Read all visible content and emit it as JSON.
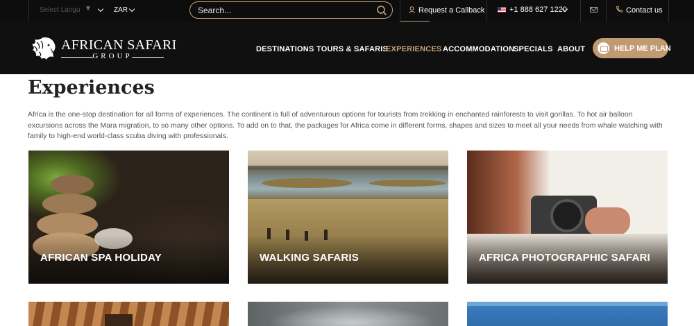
{
  "topbar": {
    "language": "Select Langu",
    "currency": "ZAR",
    "search_placeholder": "Search...",
    "callback_label": "Request a Callback",
    "phone": "+1 888 627 1220",
    "contact_label": "Contact us"
  },
  "logo": {
    "title": "AFRICAN SAFARI",
    "subtitle": "GROUP"
  },
  "nav": {
    "items": [
      {
        "label": "DESTINATIONS"
      },
      {
        "label": "TOURS & SAFARIS"
      },
      {
        "label": "EXPERIENCES"
      },
      {
        "label": "ACCOMMODATION"
      },
      {
        "label": "SPECIALS"
      },
      {
        "label": "ABOUT"
      }
    ],
    "active": "EXPERIENCES",
    "cta_label": "HELP ME PLAN"
  },
  "page": {
    "title": "Experiences",
    "intro": "Africa is the one-stop destination for all forms of experiences. The continent is full of adventurous options for tourists from trekking in enchanted rainforests to visit gorillas. To hot air balloon excursions across the Mara migration, to so many other options. To add on to that, the packages for Africa come in different forms, shapes and sizes to meet all your needs from whale watching with family to high-end world-class scuba diving with professionals."
  },
  "cards": [
    {
      "title": "AFRICAN SPA HOLIDAY"
    },
    {
      "title": "WALKING SAFARIS"
    },
    {
      "title": "AFRICA PHOTOGRAPHIC SAFARI"
    }
  ],
  "colors": {
    "accent": "#c4a27a",
    "topbar_bg": "#0d0d0d",
    "nav_bg": "#101010",
    "cta_bg": "#c09a70"
  }
}
